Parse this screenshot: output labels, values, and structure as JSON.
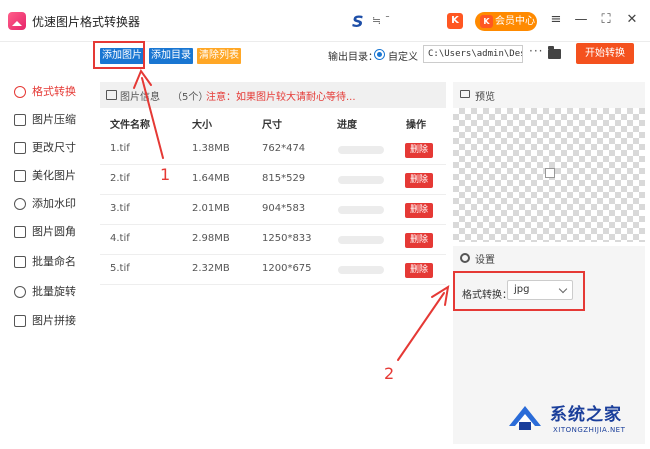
{
  "app": {
    "title": "优速图片格式转换器",
    "center_brand": "S",
    "center_text": "≒ ˉ"
  },
  "header": {
    "k_badge": "K",
    "member_label": "会员中心",
    "member_badge": "K",
    "menu_glyph": "≡",
    "minimize_glyph": "—",
    "maximize_glyph": "⛶",
    "close_glyph": "✕"
  },
  "sidebar": {
    "items": [
      {
        "label": "格式转换",
        "icon": "format-convert-icon",
        "active": true
      },
      {
        "label": "图片压缩",
        "icon": "compress-icon",
        "active": false
      },
      {
        "label": "更改尺寸",
        "icon": "resize-icon",
        "active": false
      },
      {
        "label": "美化图片",
        "icon": "beautify-icon",
        "active": false
      },
      {
        "label": "添加水印",
        "icon": "watermark-icon",
        "active": false
      },
      {
        "label": "图片圆角",
        "icon": "round-corner-icon",
        "active": false
      },
      {
        "label": "批量命名",
        "icon": "rename-icon",
        "active": false
      },
      {
        "label": "批量旋转",
        "icon": "rotate-icon",
        "active": false
      },
      {
        "label": "图片拼接",
        "icon": "stitch-icon",
        "active": false
      }
    ]
  },
  "toolbar": {
    "add_image": "添加图片",
    "add_folder": "添加目录",
    "clear_list": "清除列表",
    "output_label": "输出目录：",
    "custom_label": "自定义",
    "output_path": "C:\\Users\\admin\\Deskto",
    "more_glyph": "···",
    "start_label": "开始转换",
    "colors": {
      "add_image": "#1976d2",
      "add_folder": "#1976d2",
      "clear_list": "#ffa726",
      "start": "#f4511e"
    }
  },
  "file_panel": {
    "title": "图片信息",
    "count": "（5个）",
    "note": "注意：如果图片较大请耐心等待...",
    "columns": [
      "文件名称",
      "大小",
      "尺寸",
      "进度",
      "操作"
    ],
    "rows": [
      {
        "name": "1.tif",
        "size": "1.38MB",
        "dims": "762*474",
        "progress": 0,
        "action": "删除"
      },
      {
        "name": "2.tif",
        "size": "1.64MB",
        "dims": "815*529",
        "progress": 0,
        "action": "删除"
      },
      {
        "name": "3.tif",
        "size": "2.01MB",
        "dims": "904*583",
        "progress": 0,
        "action": "删除"
      },
      {
        "name": "4.tif",
        "size": "2.98MB",
        "dims": "1250*833",
        "progress": 0,
        "action": "删除"
      },
      {
        "name": "5.tif",
        "size": "2.32MB",
        "dims": "1200*675",
        "progress": 0,
        "action": "删除"
      }
    ]
  },
  "preview": {
    "title": "预览"
  },
  "settings": {
    "title": "设置",
    "format_label": "格式转换：",
    "format_value": "jpg"
  },
  "annotations": {
    "label_1": "1",
    "label_2": "2",
    "accent": "#e53935"
  },
  "watermark": {
    "cn": "系统之家",
    "en": "XITONGZHIJIA.NET"
  }
}
